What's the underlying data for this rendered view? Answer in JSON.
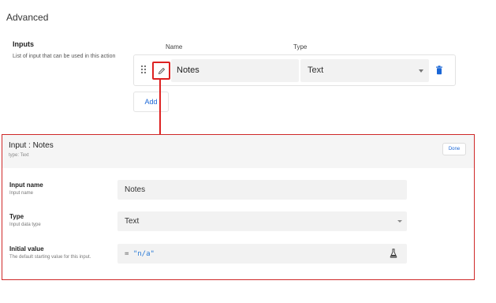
{
  "section": {
    "title": "Advanced"
  },
  "inputs": {
    "label": "Inputs",
    "description": "List of input that can be used in this action",
    "col_name": "Name",
    "col_type": "Type",
    "rows": [
      {
        "name": "Notes",
        "type": "Text"
      }
    ],
    "add_label": "Add"
  },
  "panel": {
    "title": "Input : Notes",
    "subtitle": "type: Text",
    "done_label": "Done",
    "fields": {
      "name": {
        "label": "Input name",
        "help": "Input name",
        "value": "Notes"
      },
      "type": {
        "label": "Type",
        "help": "Input data type",
        "value": "Text"
      },
      "initial": {
        "label": "Initial value",
        "help": "The default starting value for this input.",
        "prefix": "=",
        "value": "\"n/a\""
      }
    }
  },
  "icons": {
    "drag": "drag-handle-icon",
    "edit": "pencil-icon",
    "delete": "trash-icon",
    "dropdown": "chevron-down-icon",
    "expression": "flask-icon"
  },
  "colors": {
    "accent": "#1a66d6",
    "highlight": "#d22222"
  }
}
